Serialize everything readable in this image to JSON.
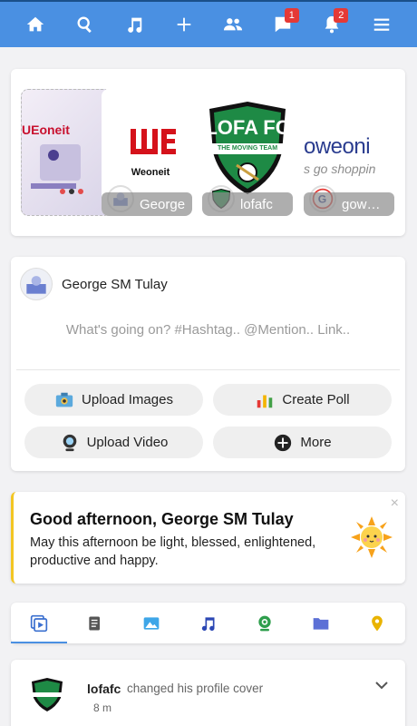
{
  "nav": {
    "items": [
      {
        "name": "home",
        "icon": "home-icon"
      },
      {
        "name": "search",
        "icon": "search-icon"
      },
      {
        "name": "music",
        "icon": "music-note-icon"
      },
      {
        "name": "add",
        "icon": "plus-icon"
      },
      {
        "name": "friends",
        "icon": "people-icon"
      },
      {
        "name": "messages",
        "icon": "chat-bubble-icon",
        "badge": "1"
      },
      {
        "name": "notifications",
        "icon": "bell-icon",
        "badge": "2"
      },
      {
        "name": "menu",
        "icon": "hamburger-icon"
      }
    ],
    "accent": "#4a90e2"
  },
  "stories": [
    {
      "label": "",
      "logo_text": "UEoneit"
    },
    {
      "label": "George",
      "logo_text": "Weoneit"
    },
    {
      "label": "lofafc",
      "logo_text": "LOFA FC"
    },
    {
      "label": "gow…",
      "logo_text": "oweoni"
    }
  ],
  "story_logo_sub": {
    "lofa_tagline": "THE MOVING TEAM",
    "gow_sub": "s go shoppin"
  },
  "composer": {
    "user_name": "George SM Tulay",
    "placeholder": "What's going on? #Hashtag.. @Mention.. Link..",
    "actions": {
      "upload_images": "Upload Images",
      "create_poll": "Create Poll",
      "upload_video": "Upload Video",
      "more": "More"
    }
  },
  "greeting": {
    "title": "Good afternoon, George SM Tulay",
    "message": "May this afternoon be light, blessed, enlightened, productive and happy.",
    "close": "×",
    "accent": "#f3c623"
  },
  "tabs": [
    {
      "name": "all",
      "icon": "media-playlist-icon",
      "active": true
    },
    {
      "name": "text",
      "icon": "document-icon"
    },
    {
      "name": "photos",
      "icon": "image-icon"
    },
    {
      "name": "music",
      "icon": "music-note-icon"
    },
    {
      "name": "video",
      "icon": "webcam-icon"
    },
    {
      "name": "files",
      "icon": "folder-icon"
    },
    {
      "name": "places",
      "icon": "location-pin-icon"
    }
  ],
  "feed": {
    "author": "lofafc",
    "action": "changed his profile cover",
    "time": "8 m"
  }
}
